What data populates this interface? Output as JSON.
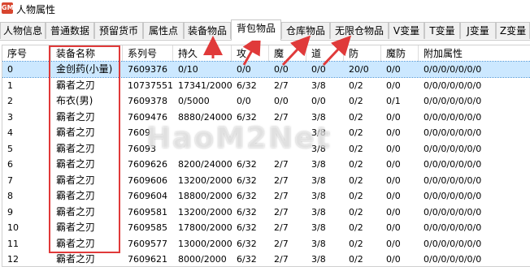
{
  "window": {
    "title": "人物属性",
    "icon": "game-icon",
    "icon_text": "GM"
  },
  "tabs": [
    {
      "label": "人物信息"
    },
    {
      "label": "普通数据"
    },
    {
      "label": "预留货币"
    },
    {
      "label": "属性点"
    },
    {
      "label": "装备物品"
    },
    {
      "label": "背包物品",
      "active": true
    },
    {
      "label": "仓库物品"
    },
    {
      "label": "无限仓物品"
    },
    {
      "label": "V变量"
    },
    {
      "label": "T变量"
    },
    {
      "label": "J变量"
    },
    {
      "label": "Z变量"
    }
  ],
  "table": {
    "columns": [
      "序号",
      "装备名称",
      "系列号",
      "持久",
      "攻",
      "魔",
      "道",
      "防",
      "魔防",
      "附加属性"
    ],
    "rows": [
      [
        "0",
        "金创药(小量)",
        "7609376",
        "0/10",
        "0/0",
        "0/0",
        "0/0",
        "20/0",
        "0/0",
        "0/0/0/0/0/0/0"
      ],
      [
        "1",
        "霸者之刃",
        "10737551",
        "17341/2000",
        "6/32",
        "2/7",
        "3/8",
        "0/2",
        "0/0",
        "0/0/0/0/0/0/0"
      ],
      [
        "2",
        "布衣(男)",
        "7609378",
        "0/5000",
        "0/0",
        "0/0",
        "0/0",
        "0/2",
        "0/1",
        "0/0/0/0/0/0/0"
      ],
      [
        "3",
        "霸者之刃",
        "7609476",
        "8880/24000",
        "6/32",
        "2/7",
        "3/8",
        "0/2",
        "0/0",
        "0/0/0/0/0/0/0"
      ],
      [
        "4",
        "霸者之刃",
        "7609",
        "",
        "",
        "",
        "3/8",
        "0/2",
        "0/0",
        "0/0/0/0/0/0/0"
      ],
      [
        "5",
        "霸者之刃",
        "76093",
        "",
        "",
        "",
        "3/8",
        "0/2",
        "0/0",
        "0/0/0/0/0/0/0"
      ],
      [
        "6",
        "霸者之刃",
        "7609626",
        "8200/24000",
        "6/32",
        "2/7",
        "3/8",
        "0/2",
        "0/0",
        "0/0/0/0/0/0/0"
      ],
      [
        "7",
        "霸者之刃",
        "7609606",
        "13200/2000",
        "6/32",
        "2/7",
        "3/8",
        "0/2",
        "0/0",
        "0/0/0/0/0/0/0"
      ],
      [
        "8",
        "霸者之刃",
        "7609604",
        "18800/2000",
        "6/32",
        "2/7",
        "3/8",
        "0/2",
        "0/0",
        "0/0/0/0/0/0/0"
      ],
      [
        "9",
        "霸者之刃",
        "7609581",
        "13200/2000",
        "6/32",
        "2/7",
        "3/8",
        "0/2",
        "0/0",
        "0/0/0/0/0/0/0"
      ],
      [
        "10",
        "霸者之刃",
        "7609585",
        "17800/2000",
        "6/32",
        "2/7",
        "3/8",
        "0/2",
        "0/0",
        "0/0/0/0/0/0/0"
      ],
      [
        "11",
        "霸者之刃",
        "7609577",
        "13000/2000",
        "6/32",
        "2/7",
        "3/8",
        "0/2",
        "0/0",
        "0/0/0/0/0/0/0"
      ],
      [
        "12",
        "霸者之刃",
        "7609621",
        "8000/2000",
        "6/32",
        "2/7",
        "3/8",
        "0/2",
        "0/0",
        "0/0/0/0/0/0/0"
      ]
    ],
    "selected_row": 0
  },
  "annotations": {
    "highlight_color": "#e03a3a"
  },
  "watermark": "HaoM2Net"
}
